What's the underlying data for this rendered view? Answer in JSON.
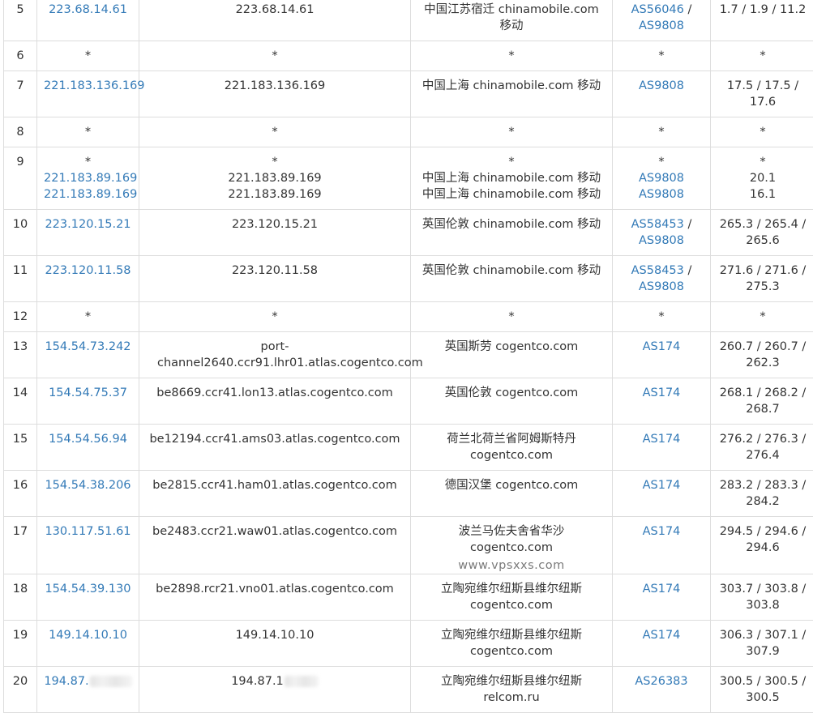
{
  "rows": [
    {
      "hop": "5",
      "ip": [
        "223.68.14.61"
      ],
      "host": [
        "223.68.14.61"
      ],
      "location": [
        "中国江苏宿迁 chinamobile.com 移动"
      ],
      "as": [
        "AS56046",
        "AS9808"
      ],
      "rtt": "1.7 / 1.9 / 11.2"
    },
    {
      "hop": "6",
      "ip": [
        "*"
      ],
      "host": [
        "*"
      ],
      "location": [
        "*"
      ],
      "as": [
        "*"
      ],
      "rtt": "*"
    },
    {
      "hop": "7",
      "ip": [
        "221.183.136.169"
      ],
      "host": [
        "221.183.136.169"
      ],
      "location": [
        "中国上海 chinamobile.com 移动"
      ],
      "as": [
        "AS9808"
      ],
      "rtt": "17.5 / 17.5 / 17.6"
    },
    {
      "hop": "8",
      "ip": [
        "*"
      ],
      "host": [
        "*"
      ],
      "location": [
        "*"
      ],
      "as": [
        "*"
      ],
      "rtt": "*"
    },
    {
      "hop": "9",
      "ip": [
        "*",
        "221.183.89.169",
        "221.183.89.169"
      ],
      "host": [
        "*",
        "221.183.89.169",
        "221.183.89.169"
      ],
      "location": [
        "*",
        "中国上海 chinamobile.com 移动",
        "中国上海 chinamobile.com 移动"
      ],
      "as": [
        "*",
        "AS9808",
        "AS9808"
      ],
      "rtt_lines": [
        "*",
        "20.1",
        "16.1"
      ]
    },
    {
      "hop": "10",
      "ip": [
        "223.120.15.21"
      ],
      "host": [
        "223.120.15.21"
      ],
      "location": [
        "英国伦敦 chinamobile.com 移动"
      ],
      "as": [
        "AS58453",
        "AS9808"
      ],
      "rtt": "265.3 / 265.4 / 265.6"
    },
    {
      "hop": "11",
      "ip": [
        "223.120.11.58"
      ],
      "host": [
        "223.120.11.58"
      ],
      "location": [
        "英国伦敦 chinamobile.com 移动"
      ],
      "as": [
        "AS58453",
        "AS9808"
      ],
      "rtt": "271.6 / 271.6 / 275.3"
    },
    {
      "hop": "12",
      "ip": [
        "*"
      ],
      "host": [
        "*"
      ],
      "location": [
        "*"
      ],
      "as": [
        "*"
      ],
      "rtt": "*"
    },
    {
      "hop": "13",
      "ip": [
        "154.54.73.242"
      ],
      "host": [
        "port-channel2640.ccr91.lhr01.atlas.cogentco.com"
      ],
      "location": [
        "英国斯劳 cogentco.com"
      ],
      "as": [
        "AS174"
      ],
      "rtt": "260.7 / 260.7 / 262.3"
    },
    {
      "hop": "14",
      "ip": [
        "154.54.75.37"
      ],
      "host": [
        "be8669.ccr41.lon13.atlas.cogentco.com"
      ],
      "location": [
        "英国伦敦 cogentco.com"
      ],
      "as": [
        "AS174"
      ],
      "rtt": "268.1 / 268.2 / 268.7"
    },
    {
      "hop": "15",
      "ip": [
        "154.54.56.94"
      ],
      "host": [
        "be12194.ccr41.ams03.atlas.cogentco.com"
      ],
      "location": [
        "荷兰北荷兰省阿姆斯特丹 cogentco.com"
      ],
      "as": [
        "AS174"
      ],
      "rtt": "276.2 / 276.3 / 276.4"
    },
    {
      "hop": "16",
      "ip": [
        "154.54.38.206"
      ],
      "host": [
        "be2815.ccr41.ham01.atlas.cogentco.com"
      ],
      "location": [
        "德国汉堡 cogentco.com"
      ],
      "as": [
        "AS174"
      ],
      "rtt": "283.2 / 283.3 / 284.2"
    },
    {
      "hop": "17",
      "ip": [
        "130.117.51.61"
      ],
      "host": [
        "be2483.ccr21.waw01.atlas.cogentco.com"
      ],
      "location": [
        "波兰马佐夫舍省华沙 cogentco.com"
      ],
      "as": [
        "AS174"
      ],
      "rtt": "294.5 / 294.6 / 294.6"
    },
    {
      "hop": "18",
      "ip": [
        "154.54.39.130"
      ],
      "host": [
        "be2898.rcr21.vno01.atlas.cogentco.com"
      ],
      "location": [
        "立陶宛维尔纽斯县维尔纽斯 cogentco.com"
      ],
      "as": [
        "AS174"
      ],
      "rtt": "303.7 / 303.8 / 303.8"
    },
    {
      "hop": "19",
      "ip": [
        "149.14.10.10"
      ],
      "host": [
        "149.14.10.10"
      ],
      "location": [
        "立陶宛维尔纽斯县维尔纽斯 cogentco.com"
      ],
      "as": [
        "AS174"
      ],
      "rtt": "306.3 / 307.1 / 307.9"
    },
    {
      "hop": "20",
      "ip": [
        "194.87."
      ],
      "host": [
        "194.87.1"
      ],
      "location": [
        "立陶宛维尔纽斯县维尔纽斯 relcom.ru"
      ],
      "as": [
        "AS26383"
      ],
      "rtt": "300.5 / 300.5 / 300.5"
    }
  ],
  "watermark": "www.vpsxxs.com"
}
